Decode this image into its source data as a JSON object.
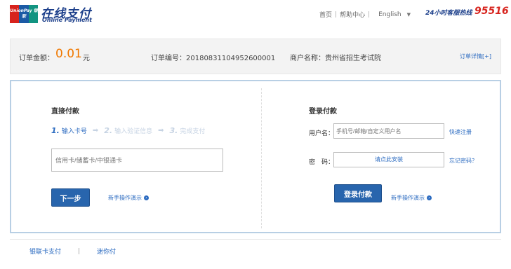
{
  "header": {
    "logo_text": "UnionPay 银联",
    "brand_cn": "在线支付",
    "brand_en": "Online Payment",
    "nav": [
      "首页",
      "帮助中心",
      "English"
    ],
    "hotline_label": "24小时客服热线",
    "hotline_number": "95516"
  },
  "order": {
    "amount_label": "订单金额：",
    "amount_value": "0.01",
    "amount_unit": "元",
    "order_no_label": "订单编号：",
    "order_no": "20180831104952600001",
    "merchant_label": "商户名称：",
    "merchant_name": "贵州省招生考试院",
    "details_link": "订单详情[+]"
  },
  "direct_pay": {
    "title": "直接付款",
    "steps": [
      {
        "num": "1.",
        "label": "输入卡号"
      },
      {
        "num": "2.",
        "label": "输入验证信息"
      },
      {
        "num": "3.",
        "label": "完成支付"
      }
    ],
    "card_placeholder": "信用卡/储蓄卡/中银通卡",
    "next_button": "下一步",
    "guide_link": "新手操作演示"
  },
  "login_pay": {
    "title": "登录付款",
    "username_label": "用户名：",
    "username_placeholder": "手机号/邮箱/自定义用户名",
    "register_link": "快速注册",
    "password_label": "密　码：",
    "password_install_text": "请点此安装",
    "forgot_link": "忘记密码？",
    "login_button": "登录付款",
    "guide_link": "新手操作演示"
  },
  "tabs": [
    "银联卡支付",
    "迷你付"
  ],
  "colors": {
    "brand_blue": "#1b3e8a",
    "accent_orange": "#f07800",
    "link_blue": "#2a6ac0",
    "button_blue": "#2865ad",
    "hotline_red": "#d7231d"
  }
}
